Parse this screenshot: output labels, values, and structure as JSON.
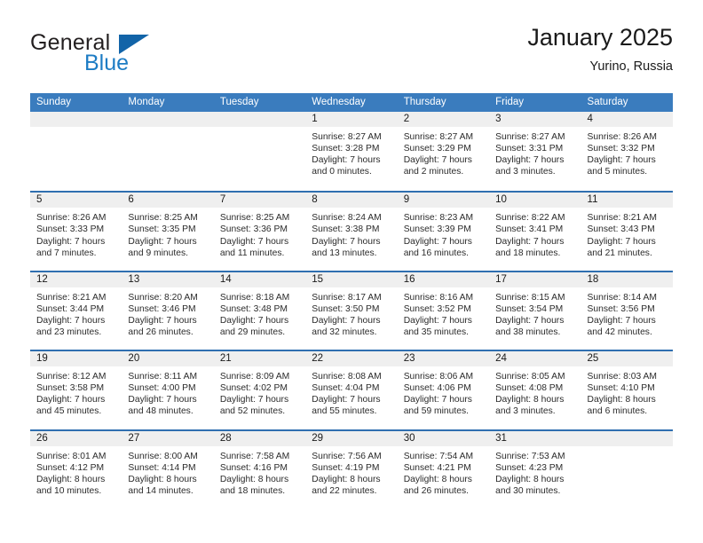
{
  "brand": {
    "word1": "General",
    "word2": "Blue",
    "accent_color": "#1264a8"
  },
  "header": {
    "title": "January 2025",
    "subtitle": "Yurino, Russia"
  },
  "calendar": {
    "header_bg": "#3a7cbe",
    "weekday_headers": [
      "Sunday",
      "Monday",
      "Tuesday",
      "Wednesday",
      "Thursday",
      "Friday",
      "Saturday"
    ],
    "weeks": [
      [
        {
          "day": "",
          "lines": []
        },
        {
          "day": "",
          "lines": []
        },
        {
          "day": "",
          "lines": []
        },
        {
          "day": "1",
          "lines": [
            "Sunrise: 8:27 AM",
            "Sunset: 3:28 PM",
            "Daylight: 7 hours",
            "and 0 minutes."
          ]
        },
        {
          "day": "2",
          "lines": [
            "Sunrise: 8:27 AM",
            "Sunset: 3:29 PM",
            "Daylight: 7 hours",
            "and 2 minutes."
          ]
        },
        {
          "day": "3",
          "lines": [
            "Sunrise: 8:27 AM",
            "Sunset: 3:31 PM",
            "Daylight: 7 hours",
            "and 3 minutes."
          ]
        },
        {
          "day": "4",
          "lines": [
            "Sunrise: 8:26 AM",
            "Sunset: 3:32 PM",
            "Daylight: 7 hours",
            "and 5 minutes."
          ]
        }
      ],
      [
        {
          "day": "5",
          "lines": [
            "Sunrise: 8:26 AM",
            "Sunset: 3:33 PM",
            "Daylight: 7 hours",
            "and 7 minutes."
          ]
        },
        {
          "day": "6",
          "lines": [
            "Sunrise: 8:25 AM",
            "Sunset: 3:35 PM",
            "Daylight: 7 hours",
            "and 9 minutes."
          ]
        },
        {
          "day": "7",
          "lines": [
            "Sunrise: 8:25 AM",
            "Sunset: 3:36 PM",
            "Daylight: 7 hours",
            "and 11 minutes."
          ]
        },
        {
          "day": "8",
          "lines": [
            "Sunrise: 8:24 AM",
            "Sunset: 3:38 PM",
            "Daylight: 7 hours",
            "and 13 minutes."
          ]
        },
        {
          "day": "9",
          "lines": [
            "Sunrise: 8:23 AM",
            "Sunset: 3:39 PM",
            "Daylight: 7 hours",
            "and 16 minutes."
          ]
        },
        {
          "day": "10",
          "lines": [
            "Sunrise: 8:22 AM",
            "Sunset: 3:41 PM",
            "Daylight: 7 hours",
            "and 18 minutes."
          ]
        },
        {
          "day": "11",
          "lines": [
            "Sunrise: 8:21 AM",
            "Sunset: 3:43 PM",
            "Daylight: 7 hours",
            "and 21 minutes."
          ]
        }
      ],
      [
        {
          "day": "12",
          "lines": [
            "Sunrise: 8:21 AM",
            "Sunset: 3:44 PM",
            "Daylight: 7 hours",
            "and 23 minutes."
          ]
        },
        {
          "day": "13",
          "lines": [
            "Sunrise: 8:20 AM",
            "Sunset: 3:46 PM",
            "Daylight: 7 hours",
            "and 26 minutes."
          ]
        },
        {
          "day": "14",
          "lines": [
            "Sunrise: 8:18 AM",
            "Sunset: 3:48 PM",
            "Daylight: 7 hours",
            "and 29 minutes."
          ]
        },
        {
          "day": "15",
          "lines": [
            "Sunrise: 8:17 AM",
            "Sunset: 3:50 PM",
            "Daylight: 7 hours",
            "and 32 minutes."
          ]
        },
        {
          "day": "16",
          "lines": [
            "Sunrise: 8:16 AM",
            "Sunset: 3:52 PM",
            "Daylight: 7 hours",
            "and 35 minutes."
          ]
        },
        {
          "day": "17",
          "lines": [
            "Sunrise: 8:15 AM",
            "Sunset: 3:54 PM",
            "Daylight: 7 hours",
            "and 38 minutes."
          ]
        },
        {
          "day": "18",
          "lines": [
            "Sunrise: 8:14 AM",
            "Sunset: 3:56 PM",
            "Daylight: 7 hours",
            "and 42 minutes."
          ]
        }
      ],
      [
        {
          "day": "19",
          "lines": [
            "Sunrise: 8:12 AM",
            "Sunset: 3:58 PM",
            "Daylight: 7 hours",
            "and 45 minutes."
          ]
        },
        {
          "day": "20",
          "lines": [
            "Sunrise: 8:11 AM",
            "Sunset: 4:00 PM",
            "Daylight: 7 hours",
            "and 48 minutes."
          ]
        },
        {
          "day": "21",
          "lines": [
            "Sunrise: 8:09 AM",
            "Sunset: 4:02 PM",
            "Daylight: 7 hours",
            "and 52 minutes."
          ]
        },
        {
          "day": "22",
          "lines": [
            "Sunrise: 8:08 AM",
            "Sunset: 4:04 PM",
            "Daylight: 7 hours",
            "and 55 minutes."
          ]
        },
        {
          "day": "23",
          "lines": [
            "Sunrise: 8:06 AM",
            "Sunset: 4:06 PM",
            "Daylight: 7 hours",
            "and 59 minutes."
          ]
        },
        {
          "day": "24",
          "lines": [
            "Sunrise: 8:05 AM",
            "Sunset: 4:08 PM",
            "Daylight: 8 hours",
            "and 3 minutes."
          ]
        },
        {
          "day": "25",
          "lines": [
            "Sunrise: 8:03 AM",
            "Sunset: 4:10 PM",
            "Daylight: 8 hours",
            "and 6 minutes."
          ]
        }
      ],
      [
        {
          "day": "26",
          "lines": [
            "Sunrise: 8:01 AM",
            "Sunset: 4:12 PM",
            "Daylight: 8 hours",
            "and 10 minutes."
          ]
        },
        {
          "day": "27",
          "lines": [
            "Sunrise: 8:00 AM",
            "Sunset: 4:14 PM",
            "Daylight: 8 hours",
            "and 14 minutes."
          ]
        },
        {
          "day": "28",
          "lines": [
            "Sunrise: 7:58 AM",
            "Sunset: 4:16 PM",
            "Daylight: 8 hours",
            "and 18 minutes."
          ]
        },
        {
          "day": "29",
          "lines": [
            "Sunrise: 7:56 AM",
            "Sunset: 4:19 PM",
            "Daylight: 8 hours",
            "and 22 minutes."
          ]
        },
        {
          "day": "30",
          "lines": [
            "Sunrise: 7:54 AM",
            "Sunset: 4:21 PM",
            "Daylight: 8 hours",
            "and 26 minutes."
          ]
        },
        {
          "day": "31",
          "lines": [
            "Sunrise: 7:53 AM",
            "Sunset: 4:23 PM",
            "Daylight: 8 hours",
            "and 30 minutes."
          ]
        },
        {
          "day": "",
          "lines": []
        }
      ]
    ]
  }
}
